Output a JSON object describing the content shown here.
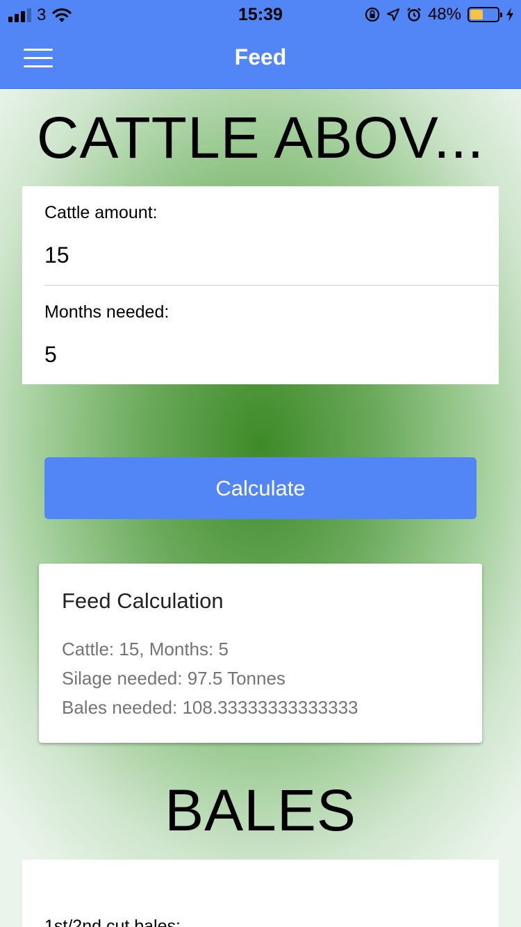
{
  "status_bar": {
    "carrier": "3",
    "time": "15:39",
    "battery_percent": "48%",
    "battery_level": 0.48,
    "battery_color": "#f6c343"
  },
  "nav": {
    "title": "Feed",
    "menu_icon": "hamburger-menu-icon",
    "color": "#5285f5"
  },
  "cattle_section": {
    "title": "CATTLE ABOV...",
    "fields": [
      {
        "label": "Cattle amount:",
        "value": "15"
      },
      {
        "label": "Months needed:",
        "value": "5"
      }
    ],
    "calculate_label": "Calculate"
  },
  "result": {
    "title": "Feed Calculation",
    "lines": [
      "Cattle: 15, Months: 5",
      "Silage needed: 97.5 Tonnes",
      "Bales needed: 108.33333333333333"
    ]
  },
  "bales_section": {
    "title": "BALES",
    "first_label": "1st/2nd cut bales:"
  }
}
